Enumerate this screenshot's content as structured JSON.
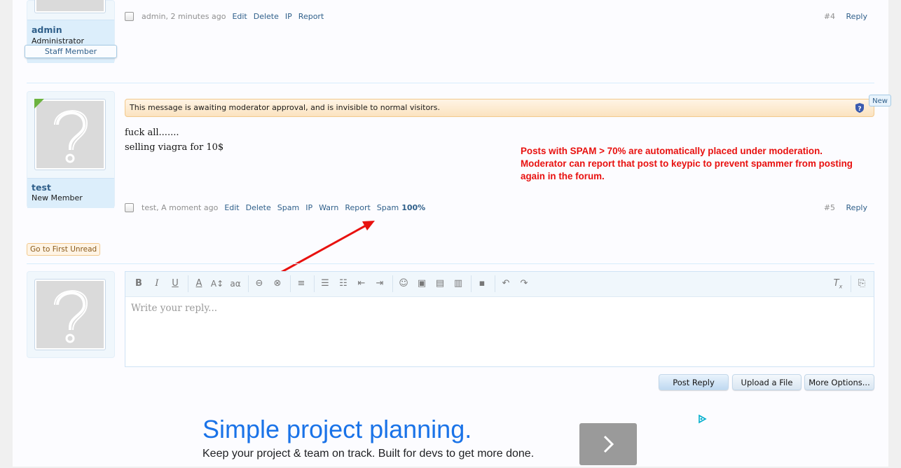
{
  "post4": {
    "username": "admin",
    "user_title": "Administrator",
    "banner": "Staff Member",
    "author_time": "admin, 2 minutes ago",
    "actions": [
      "Edit",
      "Delete",
      "IP",
      "Report"
    ],
    "number": "#4",
    "reply": "Reply"
  },
  "post5": {
    "username": "test",
    "user_title": "New Member",
    "moderation_notice": "This message is awaiting moderator approval, and is invisible to normal visitors.",
    "new_tag": "New",
    "body_line1": "fuck all.......",
    "body_line2": "selling viagra for 10$",
    "author_time": "test, A moment ago",
    "actions": [
      "Edit",
      "Delete",
      "Spam",
      "IP",
      "Warn",
      "Report"
    ],
    "spam_label": "Spam",
    "spam_score": "100%",
    "number": "#5",
    "reply": "Reply"
  },
  "annotation": {
    "line1": "Posts with SPAM  > 70% are automatically placed under moderation.",
    "line2": "Moderator can report that post to keypic to prevent spammer from posting",
    "line3": "again in the forum."
  },
  "go_first_unread": "Go to First Unread",
  "editor": {
    "placeholder": "Write your reply...",
    "toolbar": [
      "bold",
      "italic",
      "underline",
      "font-color",
      "font-size",
      "font-family",
      "link",
      "unlink",
      "align",
      "bullet-list",
      "numbered-list",
      "outdent",
      "indent",
      "smilies",
      "image",
      "media",
      "quote",
      "draft",
      "undo",
      "redo",
      "remove-formatting",
      "toggle-bbcode"
    ]
  },
  "buttons": {
    "post_reply": "Post Reply",
    "upload": "Upload a File",
    "more": "More Options..."
  },
  "ad": {
    "title": "Simple project planning.",
    "subtitle": "Keep your project & team on track. Built for devs to get more done."
  },
  "colors": {
    "link": "#2f5f8a",
    "annotation": "#e8110f",
    "ad_title": "#1a73e8"
  }
}
